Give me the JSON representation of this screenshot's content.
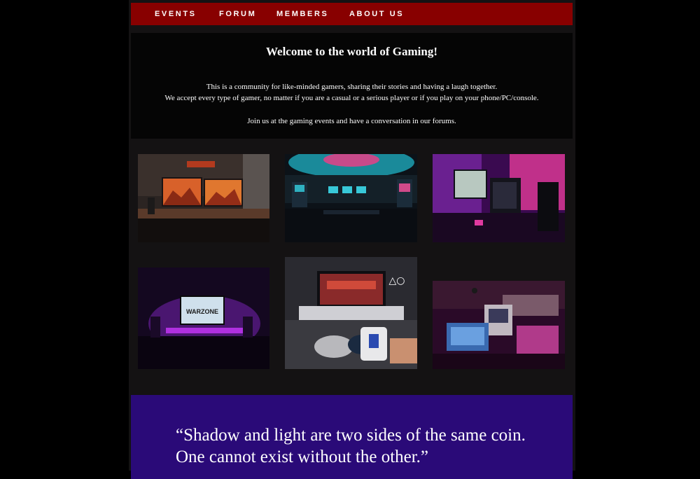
{
  "nav": {
    "items": [
      {
        "label": "EVENTS"
      },
      {
        "label": "FORUM"
      },
      {
        "label": "MEMBERS"
      },
      {
        "label": "ABOUT US"
      }
    ]
  },
  "welcome": {
    "title": "Welcome to the world of Gaming!",
    "line1": "This is a community for like-minded gamers, sharing their stories and having a laugh together.",
    "line2": "We accept every type of gamer, no matter if you are a casual or a serious player or if you play on your phone/PC/console.",
    "line3": "Join us at the gaming events and have a conversation in our forums."
  },
  "gallery": {
    "images": [
      {
        "alt": "gaming-desk-orange-wallpaper"
      },
      {
        "alt": "arcade-room-neon"
      },
      {
        "alt": "pink-gaming-pc-setup"
      },
      {
        "alt": "warzone-tv-purple-lights"
      },
      {
        "alt": "playstation-setup-mug"
      },
      {
        "alt": "retro-consoles-neon"
      }
    ]
  },
  "quote": {
    "text": "“Shadow and light are two sides of the same coin. One cannot exist without the other.”"
  },
  "colors": {
    "nav_bg": "#880000",
    "page_bg": "#141213",
    "quote_bg": "#2a0a78"
  }
}
